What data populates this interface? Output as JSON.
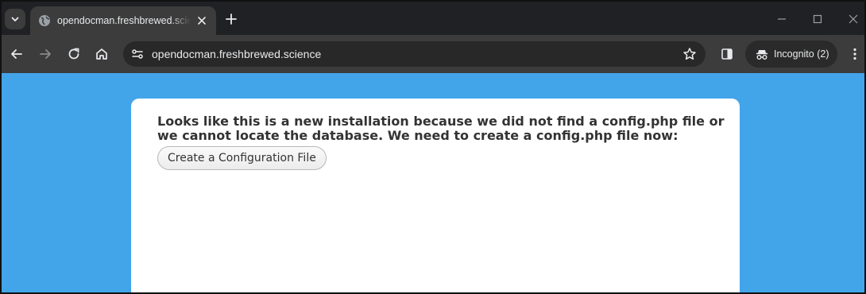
{
  "browser": {
    "tab": {
      "title": "opendocman.freshbrewed.science",
      "favicon": "globe-icon"
    },
    "address_bar": {
      "url": "opendocman.freshbrewed.science"
    },
    "incognito": {
      "label": "Incognito (2)"
    }
  },
  "page": {
    "message": "Looks like this is a new installation because we did not find a config.php file or we cannot locate the database. We need to create a config.php file now:",
    "create_config_button": "Create a Configuration File"
  },
  "colors": {
    "page_background": "#42a5ea",
    "card_background": "#ffffff",
    "browser_frame": "#3c3c3c"
  }
}
